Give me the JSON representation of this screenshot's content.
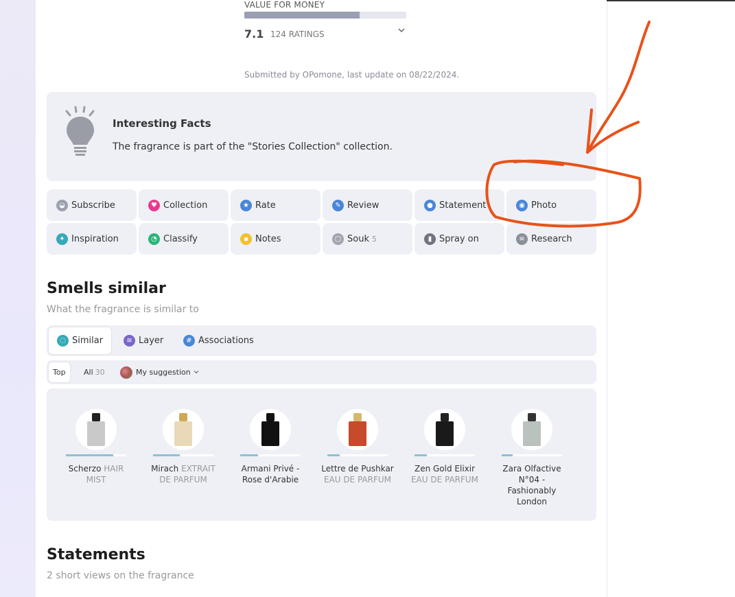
{
  "value_for_money": {
    "label": "VALUE FOR MONEY",
    "score": "7.1",
    "ratings": "124 RATINGS",
    "fill_fraction": 0.71
  },
  "submitted": "Submitted by OPomone, last update on 08/22/2024.",
  "facts": {
    "title": "Interesting Facts",
    "text": "The fragrance is part of the \"Stories Collection\" collection."
  },
  "actions": [
    {
      "label": "Subscribe",
      "icon": "bell-icon",
      "color": "#9aa0ac"
    },
    {
      "label": "Collection",
      "icon": "heart-icon",
      "color": "#e8388f"
    },
    {
      "label": "Rate",
      "icon": "star-icon",
      "color": "#4a86d8"
    },
    {
      "label": "Review",
      "icon": "pencil-icon",
      "color": "#4a86d8"
    },
    {
      "label": "Statement",
      "icon": "microphone-icon",
      "color": "#4a86d8"
    },
    {
      "label": "Photo",
      "icon": "camera-icon",
      "color": "#4a86d8"
    },
    {
      "label": "Inspiration",
      "icon": "sparkle-icon",
      "color": "#36a9b8"
    },
    {
      "label": "Classify",
      "icon": "pie-chart-icon",
      "color": "#2bb57a"
    },
    {
      "label": "Notes",
      "icon": "note-icon",
      "color": "#f2c12e"
    },
    {
      "label": "Souk",
      "icon": "bag-icon",
      "color": "#a0a4ae",
      "count": "5"
    },
    {
      "label": "Spray on",
      "icon": "spray-icon",
      "color": "#6f7480"
    },
    {
      "label": "Research",
      "icon": "database-icon",
      "color": "#8a8f99"
    }
  ],
  "smells_similar": {
    "title": "Smells similar",
    "subtitle": "What the fragrance is similar to"
  },
  "tabs": [
    {
      "label": "Similar",
      "icon": "similar-icon",
      "color": "#36a9b8"
    },
    {
      "label": "Layer",
      "icon": "layers-icon",
      "color": "#7a66c9"
    },
    {
      "label": "Associations",
      "icon": "hashtag-icon",
      "color": "#4a86d8"
    }
  ],
  "filters": {
    "top": "Top",
    "all": "All",
    "all_count": "30",
    "mine": "My suggestion"
  },
  "perfumes": [
    {
      "name": "Scherzo",
      "type": "HAIR MIST",
      "match": 0.78,
      "bottle": "#c9c9c9",
      "cap": "#222"
    },
    {
      "name": "Mirach",
      "type": "EXTRAIT DE PARFUM",
      "match": 0.44,
      "bottle": "#e9d9b8",
      "cap": "#cfa955"
    },
    {
      "name": "Armani Privé - Rose d'Arabie",
      "type": "",
      "match": 0.3,
      "bottle": "#111",
      "cap": "#111"
    },
    {
      "name": "Lettre de Pushkar",
      "type": "EAU DE PARFUM",
      "match": 0.2,
      "bottle": "#c74a2a",
      "cap": "#d9b76a"
    },
    {
      "name": "Zen Gold Elixir",
      "type": "EAU DE PARFUM",
      "match": 0.2,
      "bottle": "#1a1a1a",
      "cap": "#222"
    },
    {
      "name": "Zara Olfactive N°04 - Fashionably London",
      "type": "",
      "match": 0.18,
      "bottle": "#b9c2bd",
      "cap": "#333"
    }
  ],
  "statements": {
    "title": "Statements",
    "subtitle": "2 short views on the fragrance"
  },
  "annotation_color": "#e8521a"
}
